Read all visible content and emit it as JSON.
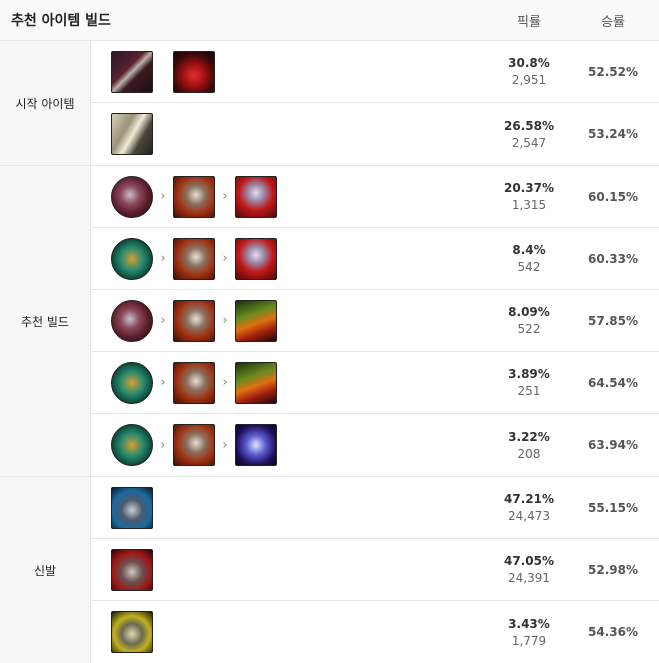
{
  "header": {
    "title": "추천 아이템 빌드",
    "pick_label": "픽률",
    "win_label": "승률"
  },
  "groups": {
    "start": {
      "label": "시작 아이템",
      "rows": [
        {
          "pick": "30.8%",
          "count": "2,951",
          "win": "52.52%"
        },
        {
          "pick": "26.58%",
          "count": "2,547",
          "win": "53.24%"
        }
      ]
    },
    "build": {
      "label": "추천 빌드",
      "rows": [
        {
          "pick": "20.37%",
          "count": "1,315",
          "win": "60.15%"
        },
        {
          "pick": "8.4%",
          "count": "542",
          "win": "60.33%"
        },
        {
          "pick": "8.09%",
          "count": "522",
          "win": "57.85%"
        },
        {
          "pick": "3.89%",
          "count": "251",
          "win": "64.54%"
        },
        {
          "pick": "3.22%",
          "count": "208",
          "win": "63.94%"
        }
      ]
    },
    "boots": {
      "label": "신발",
      "rows": [
        {
          "pick": "47.21%",
          "count": "24,473",
          "win": "55.15%"
        },
        {
          "pick": "47.05%",
          "count": "24,391",
          "win": "52.98%"
        },
        {
          "pick": "3.43%",
          "count": "1,779",
          "win": "54.36%"
        }
      ]
    }
  },
  "arrow": "›"
}
